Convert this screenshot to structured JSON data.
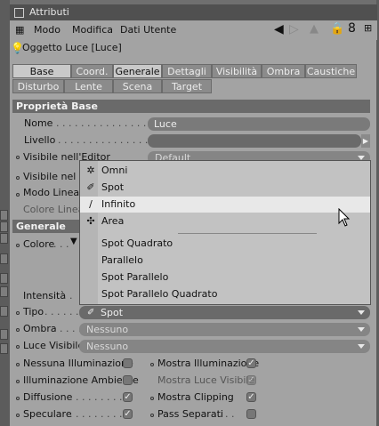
{
  "window": {
    "title": "Attributi"
  },
  "menu": {
    "items": [
      "Modo",
      "Modifica",
      "Dati Utente"
    ]
  },
  "object": {
    "label": "Oggetto Luce [Luce]"
  },
  "tabs_row1": [
    "Base",
    "Coord.",
    "Generale",
    "Dettagli",
    "Visibilità",
    "Ombra",
    "Caustiche"
  ],
  "tabs_row2": [
    "Disturbo",
    "Lente",
    "Scena",
    "Target"
  ],
  "active_tabs": [
    "Base",
    "Generale"
  ],
  "base": {
    "section_title": "Proprietà Base",
    "name_label": "Nome",
    "name_value": "Luce",
    "layer_label": "Livello",
    "vis_editor_label": "Visibile nell'Editor",
    "vis_editor_value": "Default",
    "vis_render_label": "Visibile nel Re",
    "mode_label": "Modo Linea C",
    "color_label": "Colore Linea"
  },
  "general": {
    "section_title": "Generale",
    "color_label": "Colore",
    "intensity_label": "Intensità",
    "type_label": "Tipo",
    "type_value": "Spot",
    "shadow_label": "Ombra",
    "shadow_value": "Nessuno",
    "visible_light_label": "Luce Visibile",
    "visible_light_value": "Nessuno"
  },
  "checkboxes": {
    "left": [
      {
        "label": "Nessuna Illuminazione",
        "checked": false
      },
      {
        "label": "Illuminazione Ambiente",
        "checked": false
      },
      {
        "label": "Diffusione",
        "checked": true
      },
      {
        "label": "Speculare",
        "checked": true
      }
    ],
    "right": [
      {
        "label": "Mostra Illuminazione",
        "checked": true
      },
      {
        "label": "Mostra Luce Visibile",
        "checked": true
      },
      {
        "label": "Mostra Clipping",
        "checked": true
      },
      {
        "label": "Pass Separati",
        "checked": false
      }
    ]
  },
  "popup": {
    "items": [
      "Omni",
      "Spot",
      "Infinito",
      "Area",
      "Spot Quadrato",
      "Parallelo",
      "Spot Parallelo",
      "Spot Parallelo Quadrato"
    ],
    "highlighted": "Infinito"
  }
}
